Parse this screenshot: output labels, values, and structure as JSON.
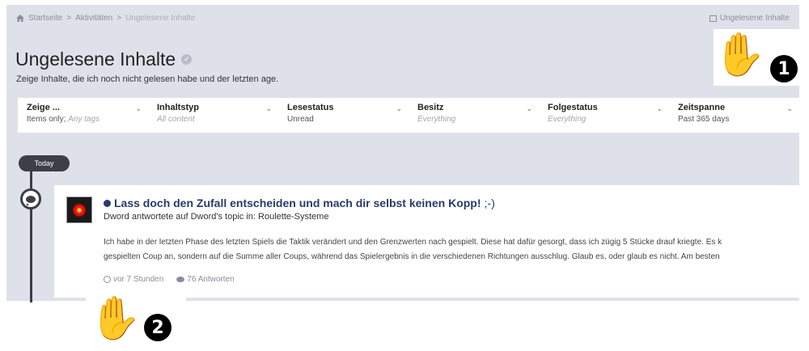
{
  "breadcrumb": {
    "items": [
      "Startseite",
      "Aktivitäten"
    ],
    "current": "Ungelesene Inhalte",
    "separator": ">"
  },
  "top_link": {
    "label": "Ungelesene Inhalte"
  },
  "page": {
    "title": "Ungelesene Inhalte",
    "subtitle": "Zeige Inhalte, die ich noch nicht gelesen habe und der letzten age."
  },
  "filters": [
    {
      "label": "Zeige ...",
      "value": "Items only;",
      "value_extra": "Any tags"
    },
    {
      "label": "Inhaltstyp",
      "value": "All content",
      "muted": true
    },
    {
      "label": "Lesestatus",
      "value": "Unread"
    },
    {
      "label": "Besitz",
      "value": "Everything",
      "muted": true
    },
    {
      "label": "Folgestatus",
      "value": "Everything",
      "muted": true
    },
    {
      "label": "Zeitspanne",
      "value": "Past 365 days"
    }
  ],
  "timeline": {
    "badge": "Today"
  },
  "activity": {
    "title": "Lass doch den Zufall entscheiden und mach dir selbst keinen Kopp!",
    "title_tail": ";-)",
    "meta": "Dword antwortete auf Dword's topic in: Roulette-Systeme",
    "body_line1": "Ich habe in der letzten Phase des letzten Spiels die Taktik verändert und den Grenzwerten nach gespielt. Diese hat dafür gesorgt, dass ich zügig 5 Stücke drauf kriegte. Es k",
    "body_line2": "gespielten Coup an, sondern auf die Summe aller Coups, während das Spielergebnis in die verschiedenen Richtungen ausschlug. Glaub es, oder glaub es nicht. Am besten",
    "time": "vor 7 Stunden",
    "replies": "76 Antworten"
  },
  "annotations": {
    "marker1": "1",
    "marker2": "2"
  },
  "colors": {
    "panel_bg": "#dfe1ea",
    "title_link": "#273b6a",
    "timeline": "#3c3f47"
  }
}
